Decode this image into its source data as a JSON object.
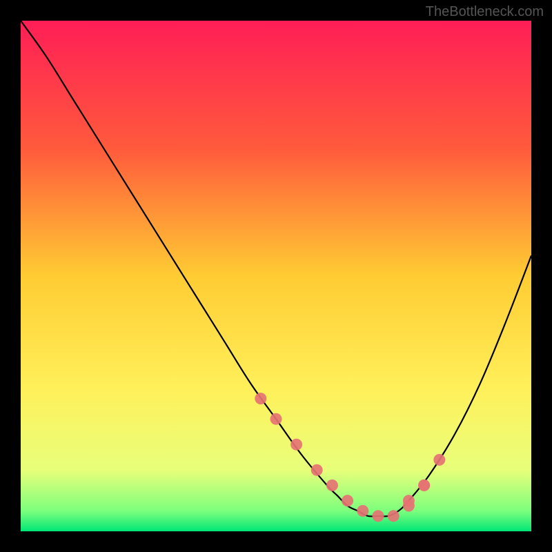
{
  "watermark": "TheBottleneck.com",
  "chart_data": {
    "type": "line",
    "title": "",
    "xlabel": "",
    "ylabel": "",
    "xlim": [
      0,
      100
    ],
    "ylim": [
      0,
      100
    ],
    "series": [
      {
        "name": "curve",
        "x": [
          0,
          5,
          10,
          15,
          20,
          25,
          30,
          35,
          40,
          45,
          50,
          55,
          60,
          62,
          64,
          66,
          68,
          70,
          72,
          74,
          76,
          80,
          85,
          90,
          95,
          100
        ],
        "y": [
          100,
          93,
          85,
          77,
          69,
          61,
          53,
          45,
          37,
          29,
          22,
          15,
          9,
          7,
          5,
          4,
          3,
          3,
          3,
          4,
          6,
          11,
          19,
          29,
          41,
          54
        ]
      }
    ],
    "markers": {
      "name": "highlight-dots",
      "x": [
        47,
        50,
        54,
        58,
        61,
        64,
        67,
        70,
        73,
        76,
        79,
        82,
        79,
        76
      ],
      "y": [
        26,
        22,
        17,
        12,
        9,
        6,
        4,
        3,
        3,
        5,
        9,
        14,
        9,
        6
      ]
    },
    "gradient_stops": [
      {
        "offset": 0,
        "color": "#ff1e56"
      },
      {
        "offset": 25,
        "color": "#ff5a3c"
      },
      {
        "offset": 50,
        "color": "#ffcc33"
      },
      {
        "offset": 72,
        "color": "#fff05a"
      },
      {
        "offset": 88,
        "color": "#e8ff7a"
      },
      {
        "offset": 96,
        "color": "#7dff7d"
      },
      {
        "offset": 100,
        "color": "#00e676"
      }
    ]
  }
}
